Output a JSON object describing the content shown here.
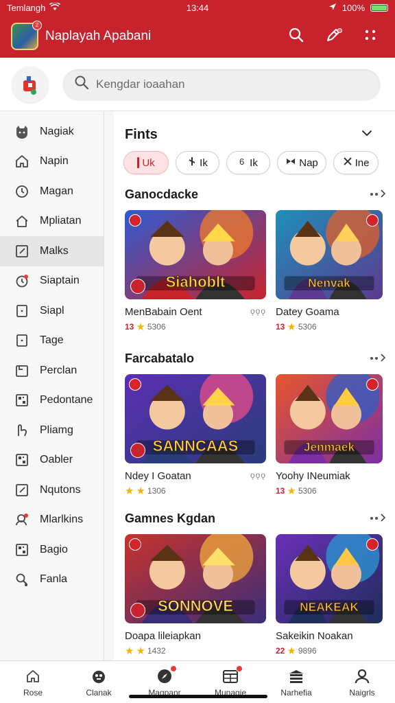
{
  "status": {
    "carrier": "Temlangh",
    "time": "13:44",
    "battery": "100%"
  },
  "app": {
    "title": "Naplayah Apabani",
    "logo_badge": "2"
  },
  "search": {
    "placeholder": "Kengdar ioaahan"
  },
  "sidebar": {
    "items": [
      {
        "label": "Nagiak",
        "icon": "cat-face-icon",
        "active": false
      },
      {
        "label": "Napin",
        "icon": "home-icon",
        "active": false
      },
      {
        "label": "Magan",
        "icon": "clock-icon",
        "active": false
      },
      {
        "label": "Mpliatan",
        "icon": "house-outline-icon",
        "active": false
      },
      {
        "label": "Malks",
        "icon": "edit-square-icon",
        "active": true
      },
      {
        "label": "Siaptain",
        "icon": "notification-icon",
        "active": false
      },
      {
        "label": "Siapl",
        "icon": "square-dot-icon",
        "active": false
      },
      {
        "label": "Tage",
        "icon": "square-dot-icon",
        "active": false
      },
      {
        "label": "Perclan",
        "icon": "square-corner-icon",
        "active": false
      },
      {
        "label": "Pedontane",
        "icon": "grid-icon",
        "active": false
      },
      {
        "label": "Pliamg",
        "icon": "hand-icon",
        "active": false
      },
      {
        "label": "Oabler",
        "icon": "grid-icon",
        "active": false
      },
      {
        "label": "Nqutons",
        "icon": "edit-square-icon",
        "active": false
      },
      {
        "label": "Mlarlkins",
        "icon": "user-badge-icon",
        "active": false
      },
      {
        "label": "Bagio",
        "icon": "grid-icon",
        "active": false
      },
      {
        "label": "Fanla",
        "icon": "search-person-icon",
        "active": false
      }
    ]
  },
  "filters": {
    "title": "Fints",
    "chips": [
      {
        "label": "Uk",
        "active": true
      },
      {
        "label": "Ik",
        "active": false
      },
      {
        "label": "Ik",
        "active": false
      },
      {
        "label": "Nap",
        "active": false
      },
      {
        "label": "Ine",
        "active": false
      }
    ]
  },
  "sections": [
    {
      "title": "Ganocdacke",
      "cards": [
        {
          "title": "MenBabain Oent",
          "ext": "ǫǫǫ",
          "rating_num": "13",
          "meta": "5306",
          "art_text": "Siahoblt"
        },
        {
          "title": "Datey Goama",
          "ext": "",
          "rating_num": "13",
          "meta": "5306",
          "art_text": "Nenvak"
        }
      ]
    },
    {
      "title": "Farcabatalo",
      "cards": [
        {
          "title": "Ndey I Goatan",
          "ext": "ǫǫǫ",
          "rating_num": "",
          "meta": "1306",
          "art_text": "SANNCAAS"
        },
        {
          "title": "Yoohy INeumiak",
          "ext": "",
          "rating_num": "13",
          "meta": "5306",
          "art_text": "Jenmaek"
        }
      ]
    },
    {
      "title": "Gamnes Kgdan",
      "cards": [
        {
          "title": "Doapa lileiapkan",
          "ext": "",
          "rating_num": "",
          "meta": "1432",
          "art_text": "SONNOVE"
        },
        {
          "title": "Sakeikin Noakan",
          "ext": "",
          "rating_num": "22",
          "meta": "9896",
          "art_text": "NEAKEAK"
        }
      ]
    }
  ],
  "bottom_nav": [
    {
      "label": "Rose",
      "icon": "home-icon"
    },
    {
      "label": "Clanak",
      "icon": "game-controller-icon"
    },
    {
      "label": "Magpanr",
      "icon": "compass-icon"
    },
    {
      "label": "Munagie",
      "icon": "calendar-icon"
    },
    {
      "label": "Narhefia",
      "icon": "library-icon"
    },
    {
      "label": "Naigrls",
      "icon": "profile-icon"
    }
  ]
}
